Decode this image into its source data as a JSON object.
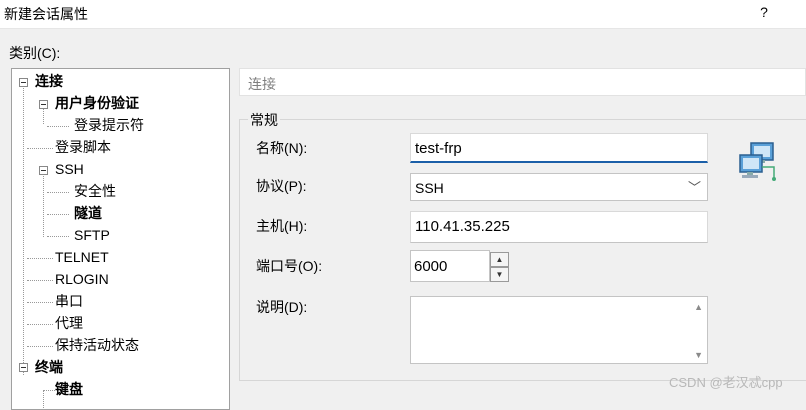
{
  "window": {
    "title": "新建会话属性",
    "help_label": "?"
  },
  "category_label": "类别(C):",
  "tree": {
    "items": [
      {
        "label": "连接",
        "bold": true,
        "expander": true
      },
      {
        "label": "用户身份验证",
        "bold": true,
        "expander": true
      },
      {
        "label": "登录提示符",
        "bold": false,
        "expander": false
      },
      {
        "label": "登录脚本",
        "bold": false,
        "expander": false
      },
      {
        "label": "SSH",
        "bold": false,
        "expander": true
      },
      {
        "label": "安全性",
        "bold": false,
        "expander": false
      },
      {
        "label": "隧道",
        "bold": true,
        "expander": false
      },
      {
        "label": "SFTP",
        "bold": false,
        "expander": false
      },
      {
        "label": "TELNET",
        "bold": false,
        "expander": false
      },
      {
        "label": "RLOGIN",
        "bold": false,
        "expander": false
      },
      {
        "label": "串口",
        "bold": false,
        "expander": false
      },
      {
        "label": "代理",
        "bold": false,
        "expander": false
      },
      {
        "label": "保持活动状态",
        "bold": false,
        "expander": false
      },
      {
        "label": "终端",
        "bold": true,
        "expander": true
      },
      {
        "label": "键盘",
        "bold": true,
        "expander": false
      }
    ]
  },
  "section_title": "连接",
  "group_title": "常规",
  "form": {
    "name_label": "名称(N):",
    "name_value": "test-frp",
    "protocol_label": "协议(P):",
    "protocol_value": "SSH",
    "host_label": "主机(H):",
    "host_value": "110.41.35.225",
    "port_label": "端口号(O):",
    "port_value": "6000",
    "desc_label": "说明(D):",
    "desc_value": ""
  },
  "icons": {
    "spin_up": "▲",
    "spin_down": "▼",
    "chevron": "﹀",
    "scroll_up": "▲",
    "scroll_down": "▼"
  },
  "watermark": "CSDN @老汉忒cpp"
}
